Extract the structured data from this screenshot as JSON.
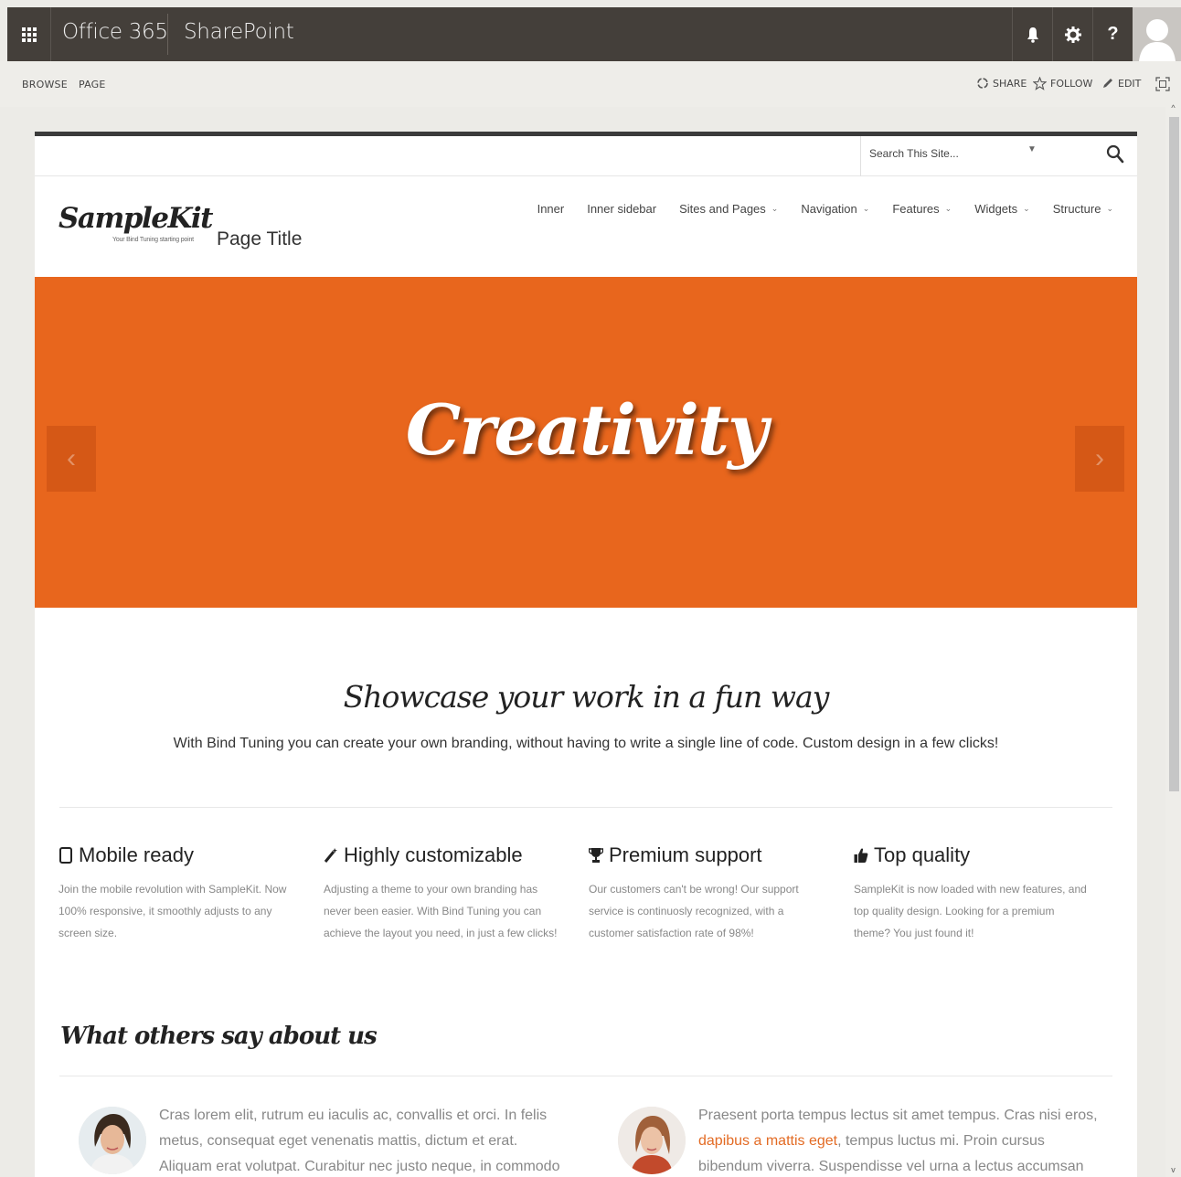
{
  "suitebar": {
    "brand": "Office 365",
    "app_name": "SharePoint",
    "icons": [
      "app-launcher-icon",
      "bell-icon",
      "gear-icon",
      "help-icon",
      "avatar"
    ],
    "help_label": "?"
  },
  "ribbon": {
    "tabs": [
      "BROWSE",
      "PAGE"
    ],
    "actions": {
      "share": "SHARE",
      "follow": "FOLLOW",
      "edit": "EDIT"
    }
  },
  "search": {
    "placeholder": "Search This Site..."
  },
  "header": {
    "logo": "SampleKit",
    "tagline": "Your Bind Tuning starting point",
    "page_title": "Page Title",
    "nav": [
      {
        "label": "Inner",
        "has_dropdown": false
      },
      {
        "label": "Inner sidebar",
        "has_dropdown": false
      },
      {
        "label": "Sites and Pages",
        "has_dropdown": true
      },
      {
        "label": "Navigation",
        "has_dropdown": true
      },
      {
        "label": "Features",
        "has_dropdown": true
      },
      {
        "label": "Widgets",
        "has_dropdown": true
      },
      {
        "label": "Structure",
        "has_dropdown": true
      }
    ]
  },
  "hero": {
    "title": "Creativity",
    "prev": "‹",
    "next": "›",
    "color": "#e8661d"
  },
  "showcase": {
    "title": "Showcase your work in a fun way",
    "subtitle": "With Bind Tuning you can create your own branding, without having to write a single line of code. Custom design in a few clicks!"
  },
  "features": [
    {
      "icon": "mobile-icon",
      "title": "Mobile ready",
      "text": "Join the mobile revolution with SampleKit. Now 100% responsive, it smoothly adjusts to any screen size."
    },
    {
      "icon": "magic-wand-icon",
      "title": "Highly customizable",
      "text": "Adjusting a theme to your own branding has never been easier. With Bind Tuning you can achieve the layout you need, in just a few clicks!"
    },
    {
      "icon": "trophy-icon",
      "title": "Premium support",
      "text": "Our customers can't be wrong! Our support service is continuosly recognized, with a customer satisfaction rate of 98%!"
    },
    {
      "icon": "thumbs-up-icon",
      "title": "Top quality",
      "text": "SampleKit is now loaded with new features, and top quality design. Looking for a premium theme? You just found it!"
    }
  ],
  "testimonials": {
    "title": "What others say about us",
    "items": [
      {
        "text": "Cras lorem elit, rutrum eu iaculis ac, convallis et orci. In felis metus, consequat eget venenatis mattis, dictum et erat. Aliquam erat volutpat. Curabitur nec justo neque, in commodo augue."
      },
      {
        "text_before": "Praesent porta tempus lectus sit amet tempus. Cras nisi eros,",
        "link": "dapibus a mattis eget",
        "text_after": ", tempus luctus mi. Proin cursus bibendum viverra. Suspendisse vel urna a lectus accumsan interdum sit amet."
      }
    ]
  },
  "colors": {
    "suitebar": "#443f3a",
    "accent": "#e8661d",
    "link": "#e36b24"
  }
}
